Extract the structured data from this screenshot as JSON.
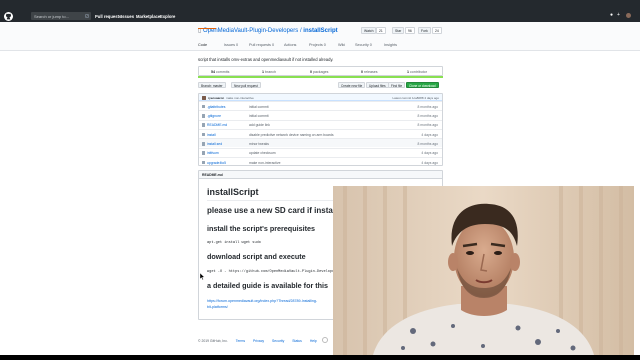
{
  "topbar": {
    "search_placeholder": "Search or jump to...",
    "search_key": "/",
    "nav": [
      "Pull requests",
      "Issues",
      "Marketplace",
      "Explore"
    ]
  },
  "repo": {
    "owner": "OpenMediaVault-Plugin-Developers",
    "separator": "/",
    "name": "installScript",
    "actions": [
      {
        "label": "Watch",
        "count": "21"
      },
      {
        "label": "Star",
        "count": "96"
      },
      {
        "label": "Fork",
        "count": "24"
      }
    ],
    "tabs": [
      "Code",
      "Issues 0",
      "Pull requests 0",
      "Actions",
      "Projects 0",
      "Wiki",
      "Security 0",
      "Insights"
    ]
  },
  "description": "script that installs omv-extras and openmediavault if not installed already.",
  "summary": [
    {
      "num": "54",
      "label": "commits"
    },
    {
      "num": "1",
      "label": "branch"
    },
    {
      "num": "0",
      "label": "packages"
    },
    {
      "num": "0",
      "label": "releases"
    },
    {
      "num": "1",
      "label": "contributor"
    }
  ],
  "toolbar": {
    "branch": "Branch: master",
    "new_pr": "New pull request",
    "create": "Create new file",
    "upload": "Upload files",
    "find": "Find file",
    "clone": "Clone or download"
  },
  "commit": {
    "user": "ryecoaaron",
    "message": "make non-interactive",
    "latest": "Latest commit 1ca8088 4 days ago"
  },
  "files": [
    {
      "name": ".gitattributes",
      "msg": "initial commit",
      "age": "8 months ago"
    },
    {
      "name": ".gitignore",
      "msg": "initial commit",
      "age": "8 months ago"
    },
    {
      "name": "README.md",
      "msg": "add guide link",
      "age": "8 months ago"
    },
    {
      "name": "install",
      "msg": "disable predictive network device naming on arm boards",
      "age": "4 days ago"
    },
    {
      "name": "install.sed",
      "msg": "minor tweaks",
      "age": "8 months ago"
    },
    {
      "name": "initfsum",
      "msg": "update checksum",
      "age": "4 days ago"
    },
    {
      "name": "upgrade4to5",
      "msg": "make non-interactive",
      "age": "4 days ago"
    }
  ],
  "readme": {
    "header": "README.md",
    "title": "installScript",
    "note": "please use a new SD card if installin",
    "h_prereq": "install the script's prerequisites",
    "cmd1": "apt-get install wget sudo",
    "h_download": "download script and execute",
    "cmd2": "wget -O - https://github.com/OpenMediaVault-Plugin-Developers/inst",
    "h_guide": "a detailed guide is available for this",
    "link1": "https://forum.openmediavault.org/index.php?Thread/28789-Installing-",
    "link2": "bit-platforms/"
  },
  "footer": {
    "copyright": "© 2019 GitHub, Inc.",
    "links": [
      "Terms",
      "Privacy",
      "Security",
      "Status",
      "Help"
    ]
  }
}
